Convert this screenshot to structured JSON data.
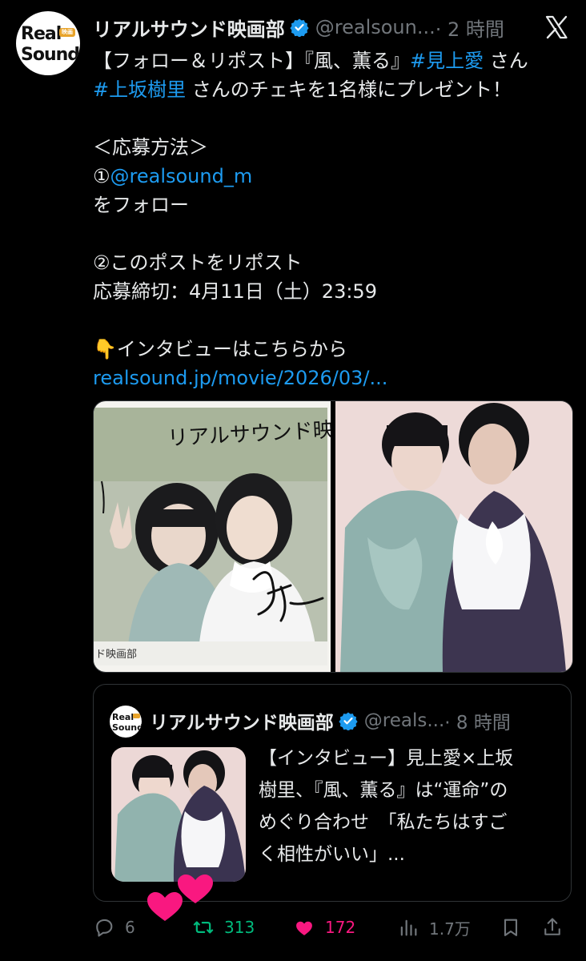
{
  "account": {
    "avatar_logo": {
      "line1": "Real",
      "tag": "映画部",
      "line2": "Sound"
    },
    "name": "リアルサウンド映画部",
    "handle": "@realsoun...",
    "time": "· 2 時間"
  },
  "post": {
    "line1_pre": "【フォロー＆リポスト】『風、薫る』",
    "hashtag1": "#見上愛",
    "line1_post": " さん",
    "hashtag2": "#上坂樹里",
    "line2_post": " さんのチェキを1名様にプレゼント！",
    "line3": "＜応募方法＞",
    "line4_num": "①",
    "mention": "@realsound_m",
    "line5": "をフォロー",
    "line6": "②このポストをリポスト",
    "line7": "応募締切：4月11日（土）23:59",
    "line8_emoji": "👇",
    "line8": "インタビューはこちらから",
    "url": "realsound.jp/movie/2026/03/..."
  },
  "media": {
    "cheki_handwriting": "リアルサウンド映",
    "cheki_footer": "ド映画部"
  },
  "quote": {
    "name": "リアルサウンド映画部",
    "handle": "@reals...",
    "time": "· 8 時間",
    "lines": [
      "【インタビュー】見上愛×上坂",
      "樹里、『風、薫る』は“運命”の",
      "めぐり合わせ　「私たちはすご",
      "く相性がいい」..."
    ]
  },
  "actions": {
    "replies": "6",
    "reposts": "313",
    "likes": "172",
    "views": "1.7万"
  },
  "colors": {
    "background": "#000000",
    "text": "#e7e9ea",
    "muted": "#71767b",
    "link": "#1d9bf0",
    "repost_active": "#00ba7c",
    "like_active": "#f91880",
    "border": "#2f3336"
  }
}
